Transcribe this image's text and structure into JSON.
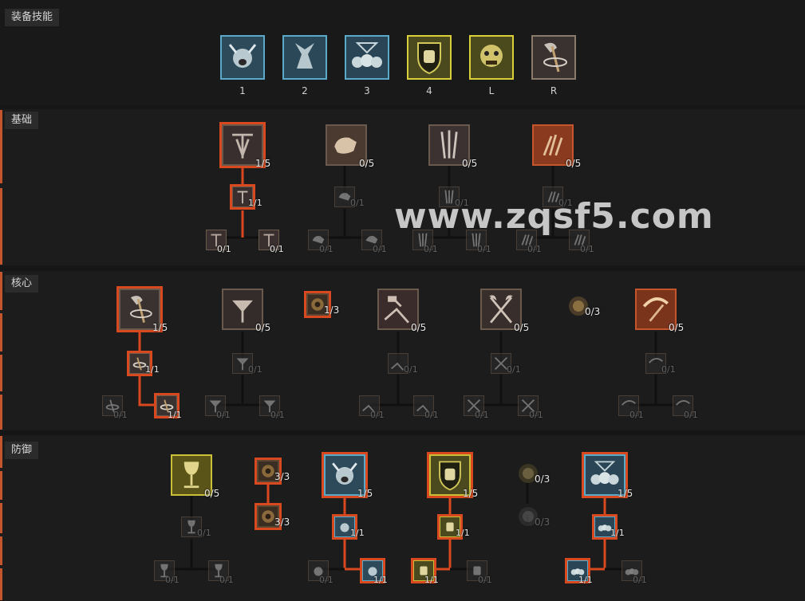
{
  "colors": {
    "accent": "#d9491f",
    "blue": "#5aa9c9",
    "yellow": "#d8cf3a",
    "sidebar": "#c4552d"
  },
  "equipped": {
    "label": "装备技能",
    "slots": [
      {
        "key": "1",
        "icon": "war-cry-icon",
        "tier": "blue"
      },
      {
        "key": "2",
        "icon": "rallying-cry-icon",
        "tier": "blue"
      },
      {
        "key": "3",
        "icon": "ancestors-skulls-icon",
        "tier": "blue"
      },
      {
        "key": "4",
        "icon": "fist-shield-icon",
        "tier": "yellow"
      },
      {
        "key": "L",
        "icon": "challenging-shout-icon",
        "tier": "yellow"
      },
      {
        "key": "R",
        "icon": "whirlwind-axe-icon",
        "tier": "plain"
      }
    ]
  },
  "sections": {
    "basic": {
      "label": "基础"
    },
    "core": {
      "label": "核心"
    },
    "defense": {
      "label": "防御"
    }
  },
  "basic_nodes": {
    "a": "1/5",
    "a1": "1/1",
    "a1a": "0/1",
    "a1b": "0/1",
    "b": "0/5",
    "b1": "0/1",
    "b1a": "0/1",
    "b1b": "0/1",
    "c": "0/5",
    "c1": "0/1",
    "c1a": "0/1",
    "c1b": "0/1",
    "d": "0/5",
    "d1": "0/1",
    "d1a": "0/1",
    "d1b": "0/1"
  },
  "core_nodes": {
    "a": "1/5",
    "a1": "1/1",
    "a1a": "0/1",
    "a1b": "1/1",
    "b": "0/5",
    "b1": "0/1",
    "b1a": "0/1",
    "b1b": "0/1",
    "orb1": "1/3",
    "c": "0/5",
    "c1": "0/1",
    "c1a": "0/1",
    "c1b": "0/1",
    "d": "0/5",
    "d1": "0/1",
    "d1a": "0/1",
    "d1b": "0/1",
    "orb2": "0/3",
    "e": "0/5",
    "e1": "0/1",
    "e1a": "0/1",
    "e1b": "0/1"
  },
  "defense_nodes": {
    "a": "0/5",
    "a1": "0/1",
    "a1a": "0/1",
    "a1b": "0/1",
    "orb1": "3/3",
    "orb2": "3/3",
    "b": "1/5",
    "b1": "1/1",
    "b1a": "0/1",
    "b1b": "1/1",
    "c": "1/5",
    "c1": "1/1",
    "c1a": "1/1",
    "c1b": "0/1",
    "orb3": "0/3",
    "orb4": "0/3",
    "d": "1/5",
    "d1": "1/1",
    "d1a": "1/1",
    "d1b": "0/1"
  },
  "watermark": "www.zqsf5.com"
}
